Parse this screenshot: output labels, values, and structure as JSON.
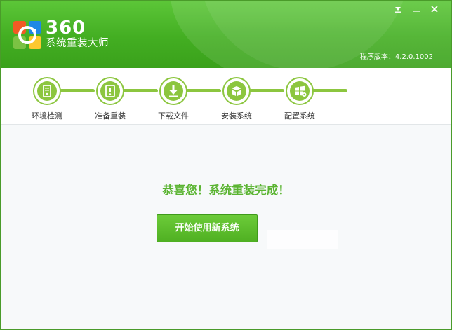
{
  "header": {
    "logo_number": "360",
    "logo_name": "系统重装大师",
    "version": "程序版本：4.2.0.1002",
    "minimize_icon": "minimize-arrow-icon",
    "close_icon": "close-icon"
  },
  "steps": [
    {
      "label": "环境检测",
      "icon": "server-check-icon"
    },
    {
      "label": "准备重装",
      "icon": "exclamation-doc-icon"
    },
    {
      "label": "下载文件",
      "icon": "download-arrow-icon"
    },
    {
      "label": "安装系统",
      "icon": "install-icon"
    },
    {
      "label": "配置系统",
      "icon": "windows-config-icon"
    }
  ],
  "main": {
    "congrats": "恭喜您！系统重装完成！",
    "start_button": "开始使用新系统"
  },
  "colors": {
    "header_green": "#43ae22",
    "step_green": "#8cc63f",
    "text_green": "#5ab431",
    "button_green": "#4fb022"
  }
}
